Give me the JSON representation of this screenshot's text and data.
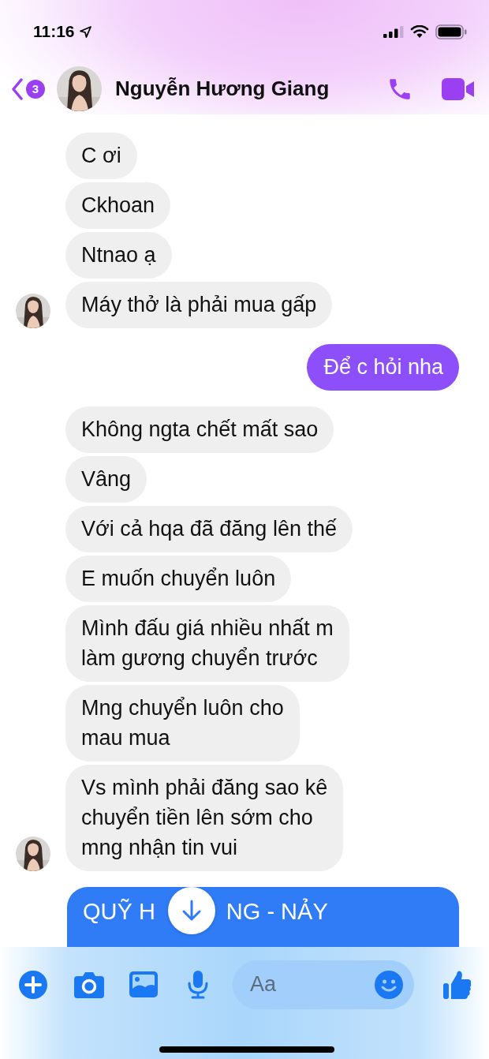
{
  "status_bar": {
    "time": "11:16"
  },
  "header": {
    "back_badge": "3",
    "contact_name": "Nguyễn Hương Giang"
  },
  "messages": [
    {
      "kind": "incoming",
      "text": "C ơi",
      "show_avatar": false
    },
    {
      "kind": "incoming",
      "text": "Ckhoan",
      "show_avatar": false
    },
    {
      "kind": "incoming",
      "text": "Ntnao ạ",
      "show_avatar": false
    },
    {
      "kind": "incoming",
      "text": "Máy thở là phải mua gấp",
      "show_avatar": true
    },
    {
      "kind": "outgoing",
      "text": "Để c hỏi nha"
    },
    {
      "kind": "incoming",
      "text": "Không ngta chết mất sao",
      "show_avatar": false
    },
    {
      "kind": "incoming",
      "text": "Vâng",
      "show_avatar": false
    },
    {
      "kind": "incoming",
      "text": "Với cả hqa đã đăng lên thế",
      "show_avatar": false
    },
    {
      "kind": "incoming",
      "text": "E muốn chuyển luôn",
      "show_avatar": false
    },
    {
      "kind": "incoming",
      "text": "Mình đấu giá nhiều nhất m\nlàm gương chuyển trước",
      "show_avatar": false
    },
    {
      "kind": "incoming",
      "text": "Mng chuyển luôn cho\nmau mua",
      "show_avatar": false
    },
    {
      "kind": "incoming",
      "text": "Vs mình phải đăng sao kê\nchuyển tiền lên sớm cho\nmng nhận tin vui",
      "show_avatar": true
    },
    {
      "kind": "card",
      "parts": [
        "QUỸ H",
        "NG - NẢY"
      ]
    }
  ],
  "composer": {
    "placeholder": "Aa"
  }
}
